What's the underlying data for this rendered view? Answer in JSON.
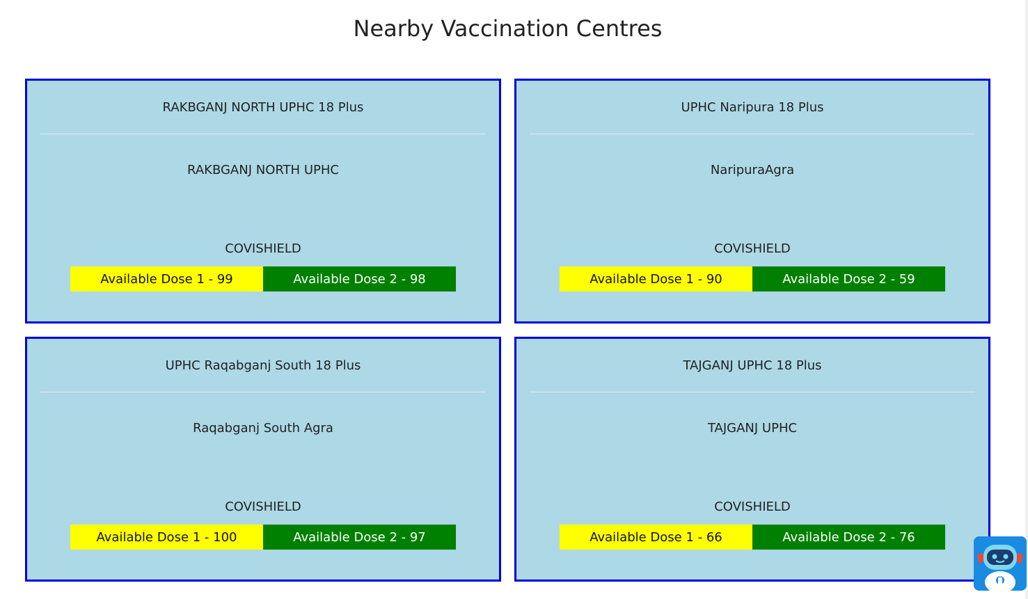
{
  "page": {
    "title": "Nearby Vaccination Centres"
  },
  "centres": [
    {
      "name": "RAKBGANJ NORTH UPHC 18 Plus",
      "address": "RAKBGANJ NORTH UPHC",
      "vaccine": "COVISHIELD",
      "dose1": "Available Dose 1 - 99",
      "dose2": "Available Dose 2 - 98"
    },
    {
      "name": "UPHC Naripura 18 Plus",
      "address": "NaripuraAgra",
      "vaccine": "COVISHIELD",
      "dose1": "Available Dose 1 - 90",
      "dose2": "Available Dose 2 - 59"
    },
    {
      "name": "UPHC Raqabganj South 18 Plus",
      "address": "Raqabganj South Agra",
      "vaccine": "COVISHIELD",
      "dose1": "Available Dose 1 - 100",
      "dose2": "Available Dose 2 - 97"
    },
    {
      "name": "TAJGANJ UPHC 18 Plus",
      "address": "TAJGANJ UPHC",
      "vaccine": "COVISHIELD",
      "dose1": "Available Dose 1 - 66",
      "dose2": "Available Dose 2 - 76"
    }
  ],
  "colors": {
    "card_bg": "#add8e6",
    "card_border": "#0000dd",
    "dose1_bg": "#ffff00",
    "dose2_bg": "#008000"
  },
  "widget": {
    "icon": "chatbot-robot-icon"
  }
}
